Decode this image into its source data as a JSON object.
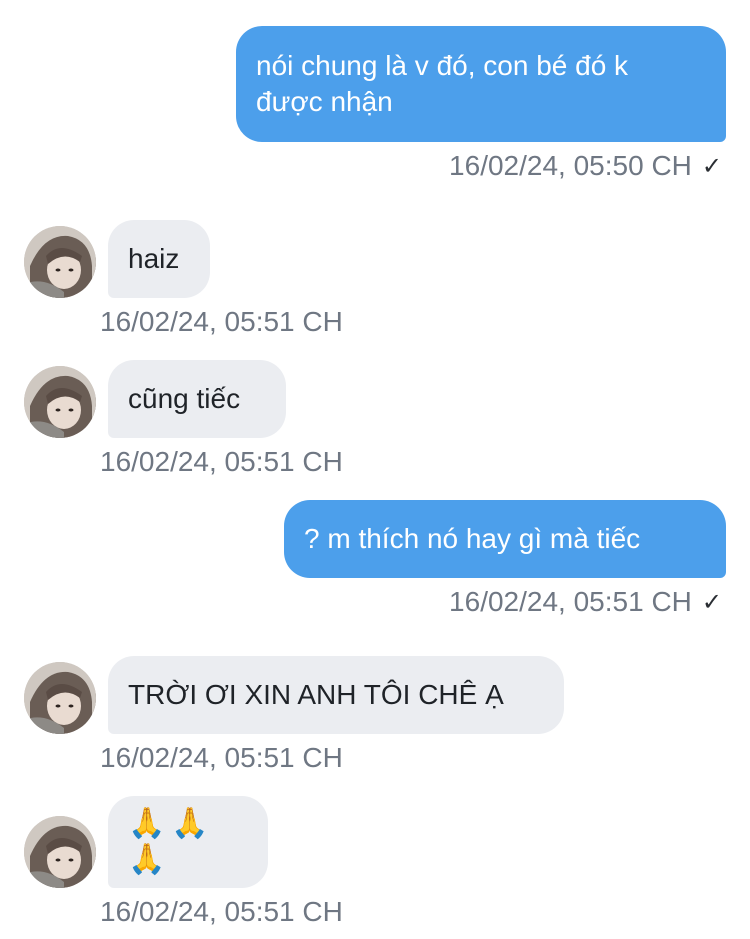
{
  "colors": {
    "sent_bubble": "#4c9feb",
    "received_bubble": "#ebedf1",
    "timestamp": "#6f7783"
  },
  "messages": [
    {
      "direction": "sent",
      "text": "nói chung là v đó, con bé đó k được nhận",
      "line1": "nói chung là v đó, con bé đó k",
      "line2": "được nhận",
      "time": "16/02/24, 05:50 CH",
      "status": "✓"
    },
    {
      "direction": "received",
      "text": "haiz",
      "time": "16/02/24, 05:51 CH",
      "avatar": "contact-avatar"
    },
    {
      "direction": "received",
      "text": "cũng tiếc",
      "time": "16/02/24, 05:51 CH",
      "avatar": "contact-avatar"
    },
    {
      "direction": "sent",
      "text": "? m thích nó hay gì mà tiếc",
      "time": "16/02/24, 05:51 CH",
      "status": "✓"
    },
    {
      "direction": "received",
      "text": "TRỜI ƠI XIN ANH TÔI CHÊ Ạ",
      "time": "16/02/24, 05:51 CH",
      "avatar": "contact-avatar"
    },
    {
      "direction": "received",
      "text": "🙏🙏🙏",
      "time": "16/02/24, 05:51 CH",
      "avatar": "contact-avatar"
    }
  ]
}
